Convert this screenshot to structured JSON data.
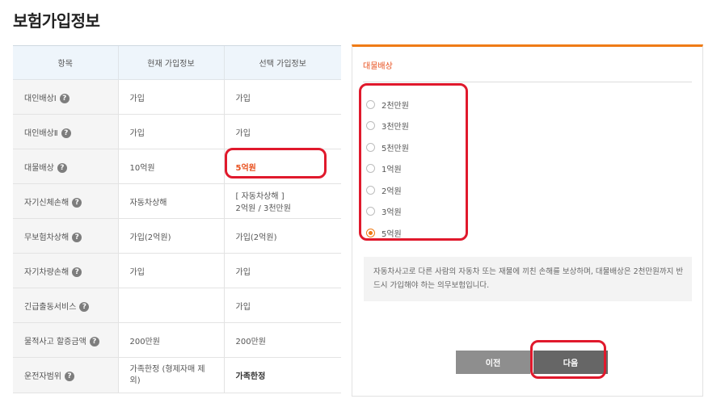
{
  "page_title": "보험가입정보",
  "table": {
    "headers": [
      "항목",
      "현재 가입정보",
      "선택 가입정보"
    ],
    "rows": [
      {
        "item": "대인배상Ⅰ",
        "current": "가입",
        "selected": "가입"
      },
      {
        "item": "대인배상Ⅱ",
        "current": "가입",
        "selected": "가입"
      },
      {
        "item": "대물배상",
        "current": "10억원",
        "selected": "5억원"
      },
      {
        "item": "자기신체손해",
        "current": "자동차상해",
        "selected_line1": "[ 자동차상해 ]",
        "selected_line2": "2억원 / 3천만원"
      },
      {
        "item": "무보험차상해",
        "current": "가입(2억원)",
        "selected": "가입(2억원)"
      },
      {
        "item": "자기차량손해",
        "current": "가입",
        "selected": "가입"
      },
      {
        "item": "긴급출동서비스",
        "current": "",
        "selected": "가입"
      },
      {
        "item": "물적사고 할증금액",
        "current": "200만원",
        "selected": "200만원"
      },
      {
        "item": "운전자범위",
        "current": "가족한정 (형제자매 제외)",
        "selected": "가족한정"
      }
    ],
    "help_symbol": "?"
  },
  "panel": {
    "title": "대물배상",
    "options": [
      "2천만원",
      "3천만원",
      "5천만원",
      "1억원",
      "2억원",
      "3억원",
      "5억원"
    ],
    "selected_index": 6,
    "description": "자동차사고로 다른 사람의 자동차 또는 재물에 끼친 손해를 보상하며, 대물배상은 2천만원까지 반드시 가입해야 하는 의무보험입니다.",
    "prev_label": "이전",
    "next_label": "다음"
  },
  "colors": {
    "accent": "#ef7b16",
    "highlight_text": "#e8501e",
    "annotation": "#e0192c"
  }
}
